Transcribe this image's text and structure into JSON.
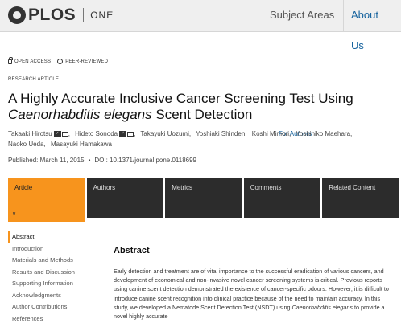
{
  "header": {
    "logo_text": "PLOS",
    "logo_sub": "ONE",
    "nav": [
      "Subject Areas",
      "For Authors",
      "About Us"
    ]
  },
  "flags": {
    "open_access": "OPEN ACCESS",
    "peer_reviewed": "PEER-REVIEWED"
  },
  "article_type": "RESEARCH ARTICLE",
  "title": {
    "line1": "A Highly Accurate Inclusive Cancer Screening Test Using",
    "italic": "Caenorhabditis elegans",
    "rest": "Scent Detection"
  },
  "authors": [
    "Takaaki Hirotsu",
    "Hideto Sonoda",
    "Takayuki Uozumi",
    "Yoshiaki Shinden",
    "Koshi Mimori",
    "Yoshihiko Maehara",
    "Naoko Ueda",
    "Masayuki Hamakawa"
  ],
  "published": "Published: March 11, 2015",
  "doi": "DOI: 10.1371/journal.pone.0118699",
  "tabs": [
    "Article",
    "Authors",
    "Metrics",
    "Comments",
    "Related Content"
  ],
  "sidenav": [
    "Abstract",
    "Introduction",
    "Materials and Methods",
    "Results and Discussion",
    "Supporting Information",
    "Acknowledgments",
    "Author Contributions",
    "References"
  ],
  "abstract": {
    "heading": "Abstract",
    "text_before_italic": "Early detection and treatment are of vital importance to the successful eradication of various cancers, and development of economical and non-invasive novel cancer screening systems is critical. Previous reports using canine scent detection demonstrated the existence of cancer-specific odours. However, it is difficult to introduce canine scent recognition into clinical practice because of the need to maintain accuracy. In this study, we developed a Nematode Scent Detection Test (NSDT) using",
    "italic": "Caenorhabditis elegans",
    "text_after_italic": "to provide a novel highly accurate"
  },
  "colors": {
    "accent": "#f7941d",
    "tab_bg": "#2c2c2c",
    "link": "#16639e",
    "header_bg": "#efefef"
  }
}
